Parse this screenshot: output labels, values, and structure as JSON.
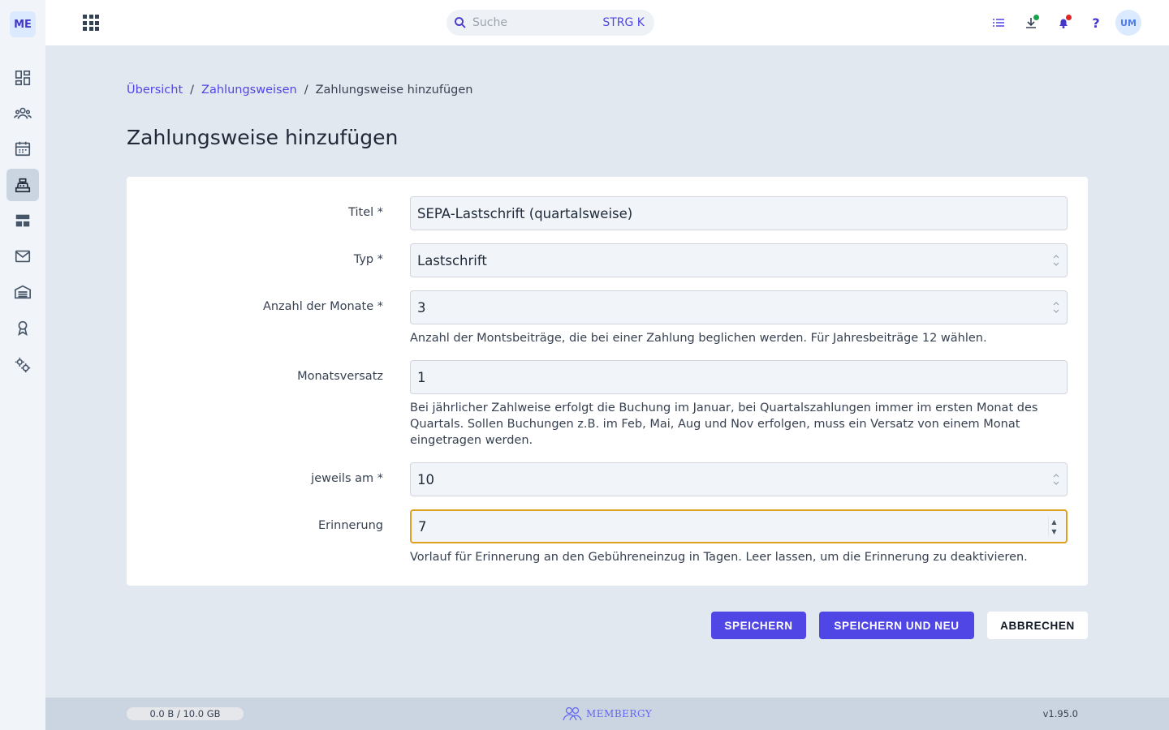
{
  "app": {
    "logo": "ME",
    "accent": "#4f46e5"
  },
  "sidebar": {
    "items": [
      {
        "name": "dashboard-icon",
        "active": false
      },
      {
        "name": "members-icon",
        "active": false
      },
      {
        "name": "calendar-icon",
        "active": false
      },
      {
        "name": "cash-register-icon",
        "active": true
      },
      {
        "name": "layout-icon",
        "active": false
      },
      {
        "name": "mail-icon",
        "active": false
      },
      {
        "name": "warehouse-icon",
        "active": false
      },
      {
        "name": "award-icon",
        "active": false
      },
      {
        "name": "settings-icon",
        "active": false
      }
    ]
  },
  "topbar": {
    "search_placeholder": "Suche",
    "search_shortcut": "STRG K",
    "avatar": "UM",
    "icons": [
      "task-list-icon",
      "download-icon",
      "bell-icon",
      "help-icon"
    ],
    "help_label": "?"
  },
  "breadcrumb": {
    "items": [
      "Übersicht",
      "Zahlungsweisen"
    ],
    "current": "Zahlungsweise hinzufügen",
    "separator": "/"
  },
  "page": {
    "title": "Zahlungsweise hinzufügen"
  },
  "form": {
    "title_label": "Titel *",
    "title_value": "SEPA-Lastschrift (quartalsweise)",
    "type_label": "Typ *",
    "type_value": "Lastschrift",
    "months_label": "Anzahl der Monate *",
    "months_value": "3",
    "months_help": "Anzahl der Montsbeiträge, die bei einer Zahlung beglichen werden. Für Jahresbeiträge 12 wählen.",
    "offset_label": "Monatsversatz",
    "offset_value": "1",
    "offset_help": "Bei jährlicher Zahlweise erfolgt die Buchung im Januar, bei Quartalszahlungen immer im ersten Monat des Quartals. Sollen Buchungen z.B. im Feb, Mai, Aug und Nov erfolgen, muss ein Versatz von einem Monat eingetragen werden.",
    "day_label": "jeweils am *",
    "day_value": "10",
    "reminder_label": "Erinnerung",
    "reminder_value": "7",
    "reminder_help": "Vorlauf für Erinnerung an den Gebühreneinzug in Tagen. Leer lassen, um die Erinnerung zu deaktivieren."
  },
  "actions": {
    "save": "SPEICHERN",
    "save_new": "SPEICHERN UND NEU",
    "cancel": "ABBRECHEN"
  },
  "footer": {
    "storage": "0.0 B / 10.0 GB",
    "brand": "MEMBERGY",
    "version": "v1.95.0"
  }
}
